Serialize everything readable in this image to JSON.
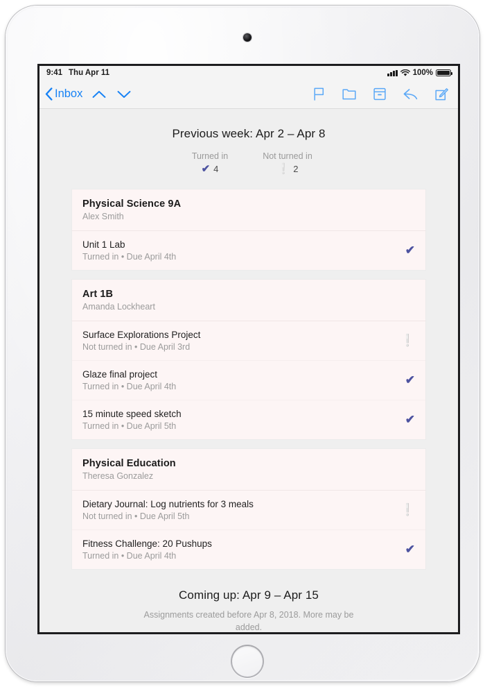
{
  "device": {
    "camera_icon": "camera-dot",
    "home_button_icon": "home-button"
  },
  "status_bar": {
    "time": "9:41",
    "date": "Thu Apr 11",
    "signal_icon": "signal-bars-icon",
    "wifi_icon": "wifi-icon",
    "battery_percent": "100%",
    "battery_icon": "battery-full-icon"
  },
  "navbar": {
    "back_label": "Inbox",
    "back_icon": "chevron-left-icon",
    "previous_message_icon": "chevron-up-icon",
    "next_message_icon": "chevron-down-icon",
    "flag_icon": "flag-icon",
    "folder_icon": "folder-icon",
    "archive_icon": "archive-icon",
    "reply_icon": "reply-icon",
    "compose_icon": "compose-icon"
  },
  "message": {
    "week_title": "Previous week: Apr 2 – Apr 8",
    "summary": [
      {
        "label": "Turned in",
        "icon": "check-icon",
        "value": "4"
      },
      {
        "label": "Not turned in",
        "icon": "exclamation-icon",
        "value": "2"
      }
    ],
    "classes": [
      {
        "name": "Physical Science 9A",
        "teacher": "Alex Smith",
        "assignments": [
          {
            "title": "Unit 1 Lab",
            "meta": "Turned in  •  Due April 4th",
            "status": "turned-in",
            "status_icon": "check-icon"
          }
        ]
      },
      {
        "name": "Art 1B",
        "teacher": "Amanda Lockheart",
        "assignments": [
          {
            "title": "Surface Explorations Project",
            "meta": "Not turned in  •  Due April 3rd",
            "status": "not-turned-in",
            "status_icon": "exclamation-icon"
          },
          {
            "title": "Glaze final project",
            "meta": "Turned in  •  Due April 4th",
            "status": "turned-in",
            "status_icon": "check-icon"
          },
          {
            "title": "15 minute speed sketch",
            "meta": "Turned in  •  Due April 5th",
            "status": "turned-in",
            "status_icon": "check-icon"
          }
        ]
      },
      {
        "name": "Physical Education",
        "teacher": "Theresa Gonzalez",
        "assignments": [
          {
            "title": "Dietary Journal: Log nutrients for 3 meals",
            "meta": "Not turned in  •  Due April 5th",
            "status": "not-turned-in",
            "status_icon": "exclamation-icon"
          },
          {
            "title": "Fitness Challenge: 20 Pushups",
            "meta": "Turned in  •  Due April 4th",
            "status": "turned-in",
            "status_icon": "check-icon"
          }
        ]
      }
    ],
    "footer_title": "Coming up: Apr 9 – Apr 15",
    "footer_note": "Assignments created before Apr 8, 2018. More may be added."
  },
  "colors": {
    "accent_blue": "#1782f5",
    "check_purple": "#4d53a0",
    "alert_red": "#cc1133",
    "card_background": "#fdf5f5",
    "page_background": "#efefef"
  }
}
